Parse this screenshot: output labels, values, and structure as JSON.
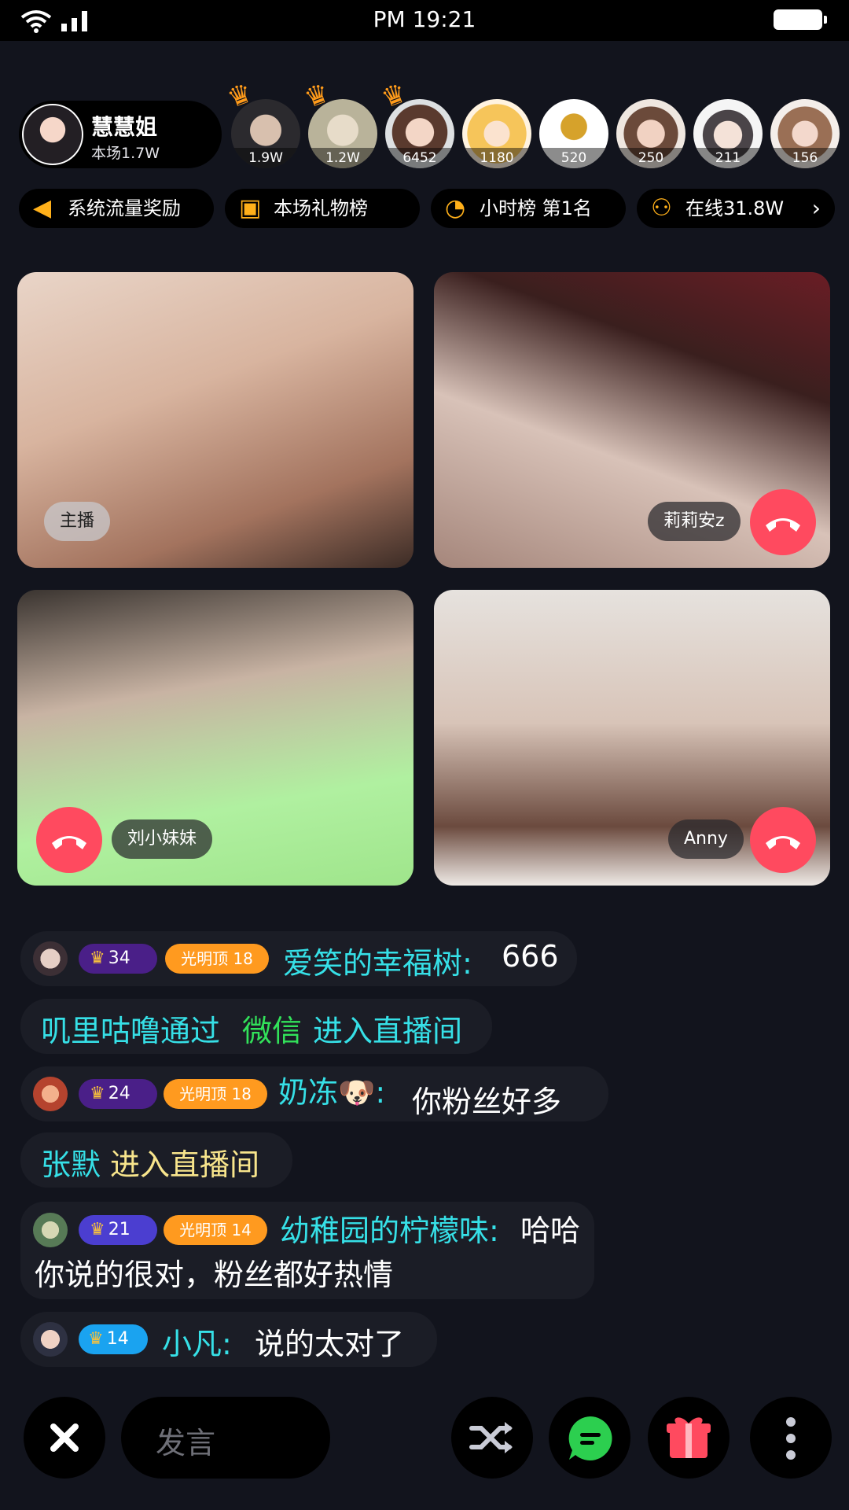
{
  "status": {
    "time": "PM 19:21"
  },
  "host": {
    "name": "慧慧姐",
    "subtitle": "本场1.7W"
  },
  "viewers": [
    {
      "count": "1.9W"
    },
    {
      "count": "1.2W"
    },
    {
      "count": "6452"
    },
    {
      "count": "1180"
    },
    {
      "count": "520"
    },
    {
      "count": "250"
    },
    {
      "count": "211"
    },
    {
      "count": "156"
    }
  ],
  "info_pills": [
    {
      "label": "系统流量奖励",
      "icon": "speaker-icon",
      "color": "#ffb01a"
    },
    {
      "label": "本场礼物榜",
      "icon": "gift-icon",
      "color": "#ffb01a"
    },
    {
      "label": "小时榜  第1名",
      "icon": "clock-icon",
      "color": "#ffb01a"
    },
    {
      "label": "在线31.8W",
      "icon": "users-icon",
      "color": "#ffb01a"
    }
  ],
  "tiles": [
    {
      "label": "主播"
    },
    {
      "label": "莉莉安z"
    },
    {
      "label": "刘小妹妹"
    },
    {
      "label": "Anny"
    }
  ],
  "chat": [
    {
      "level": "34",
      "badge": "光明顶 18",
      "name": "爱笑的幸福树:",
      "text": "666"
    },
    {
      "name": "叽里咕噜通过",
      "via": "微信",
      "action": "进入直播间"
    },
    {
      "level": "24",
      "badge": "光明顶 18",
      "name": "奶冻🐶:",
      "text": "你粉丝好多"
    },
    {
      "name": "张默",
      "action": "进入直播间"
    },
    {
      "level": "21",
      "badge": "光明顶 14",
      "name": "幼稚园的柠檬味:",
      "text": "哈哈",
      "text2": "你说的很对，粉丝都好热情"
    },
    {
      "level": "14",
      "name": "小凡:",
      "text": "说的太对了"
    }
  ],
  "bottom": {
    "input_placeholder": "发言"
  },
  "colors": {
    "accent_red": "#ff4a5f",
    "cyan": "#36e0e7",
    "orange": "#ff9a1f",
    "green_chat": "#2ccf4f"
  }
}
